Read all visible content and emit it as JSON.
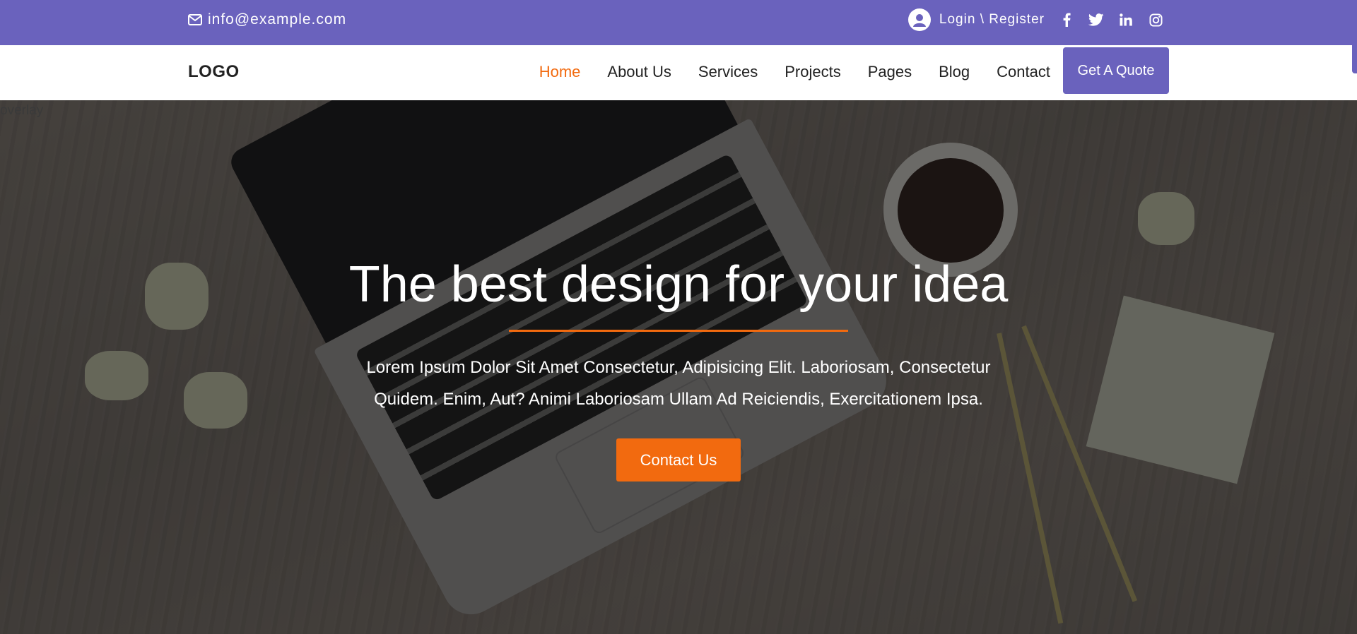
{
  "topbar": {
    "email": "info@example.com",
    "login_register": "Login \\ Register",
    "social": [
      "facebook-icon",
      "twitter-icon",
      "linkedin-icon",
      "instagram-icon"
    ],
    "color": "#6a62bd"
  },
  "navbar": {
    "logo": "LOGO",
    "items": [
      {
        "label": "Home",
        "active": true
      },
      {
        "label": "About Us"
      },
      {
        "label": "Services"
      },
      {
        "label": "Projects"
      },
      {
        "label": "Pages"
      },
      {
        "label": "Blog"
      },
      {
        "label": "Contact"
      }
    ],
    "quote_label": "Get A Quote",
    "active_color": "#f26a0f"
  },
  "hero": {
    "overlay_label": "overlay",
    "title": "The best design for your idea",
    "text": "Lorem Ipsum Dolor Sit Amet Consectetur, Adipisicing Elit. Laboriosam, Consectetur Quidem. Enim, Aut? Animi Laboriosam Ullam Ad Reiciendis, Exercitationem Ipsa.",
    "button_label": "Contact Us",
    "accent_color": "#f26a0f"
  }
}
